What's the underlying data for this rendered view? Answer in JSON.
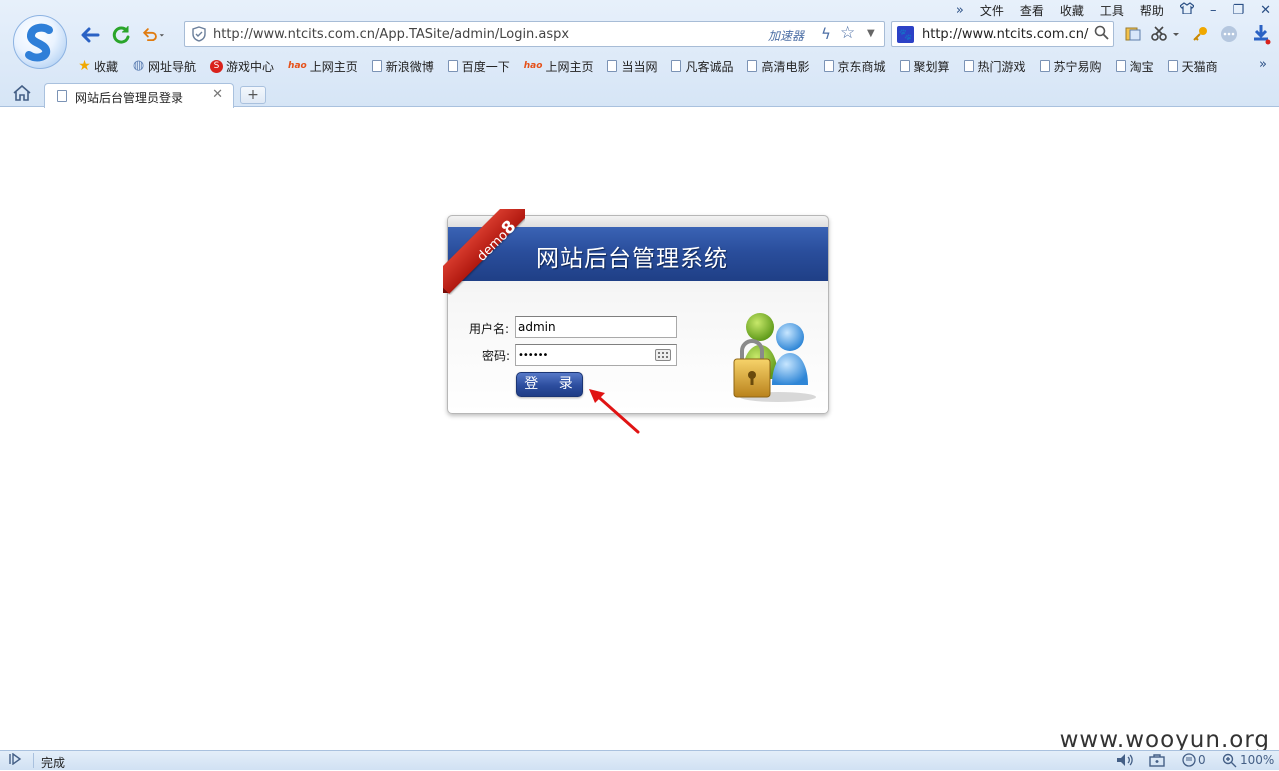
{
  "browser": {
    "menu": {
      "more": "»",
      "items": [
        "文件",
        "查看",
        "收藏",
        "工具",
        "帮助"
      ],
      "skin_icon": "shirt-icon",
      "minimize": "–",
      "restore": "❐",
      "close": "✕"
    },
    "address": {
      "url": "http://www.ntcits.com.cn/App.TASite/admin/Login.aspx",
      "accelerator_label": "加速器"
    },
    "search": {
      "value": "http://www.ntcits.com.cn/"
    },
    "bookmarks": [
      {
        "label": "收藏",
        "icon": "star-icon"
      },
      {
        "label": "网址导航",
        "icon": "globe-icon"
      },
      {
        "label": "游戏中心",
        "icon": "game-icon"
      },
      {
        "label": "上网主页",
        "icon": "hao-icon"
      },
      {
        "label": "新浪微博",
        "icon": "page-icon"
      },
      {
        "label": "百度一下",
        "icon": "page-icon"
      },
      {
        "label": "上网主页",
        "icon": "hao-icon"
      },
      {
        "label": "当当网",
        "icon": "page-icon"
      },
      {
        "label": "凡客诚品",
        "icon": "page-icon"
      },
      {
        "label": "高清电影",
        "icon": "page-icon"
      },
      {
        "label": "京东商城",
        "icon": "page-icon"
      },
      {
        "label": "聚划算",
        "icon": "page-icon"
      },
      {
        "label": "热门游戏",
        "icon": "page-icon"
      },
      {
        "label": "苏宁易购",
        "icon": "page-icon"
      },
      {
        "label": "淘宝",
        "icon": "page-icon"
      },
      {
        "label": "天猫商",
        "icon": "page-icon"
      }
    ],
    "hao_text": "hao",
    "bookmarks_more": "»",
    "tab": {
      "title": "网站后台管理员登录",
      "close": "✕"
    },
    "new_tab": "+",
    "status": {
      "text": "完成",
      "ie_count": "0",
      "zoom": "100%"
    }
  },
  "login": {
    "ribbon": {
      "word": "demo",
      "digit": "8"
    },
    "title": "网站后台管理系统",
    "username_label": "用户名:",
    "username_value": "admin",
    "password_label": "密码:",
    "password_value": "••••••",
    "submit_label": "登 录"
  },
  "watermark": "www.wooyun.org",
  "colors": {
    "banner": "#2a4e9c",
    "ribbon": "#c42b1f",
    "arrow": "#e01414"
  }
}
